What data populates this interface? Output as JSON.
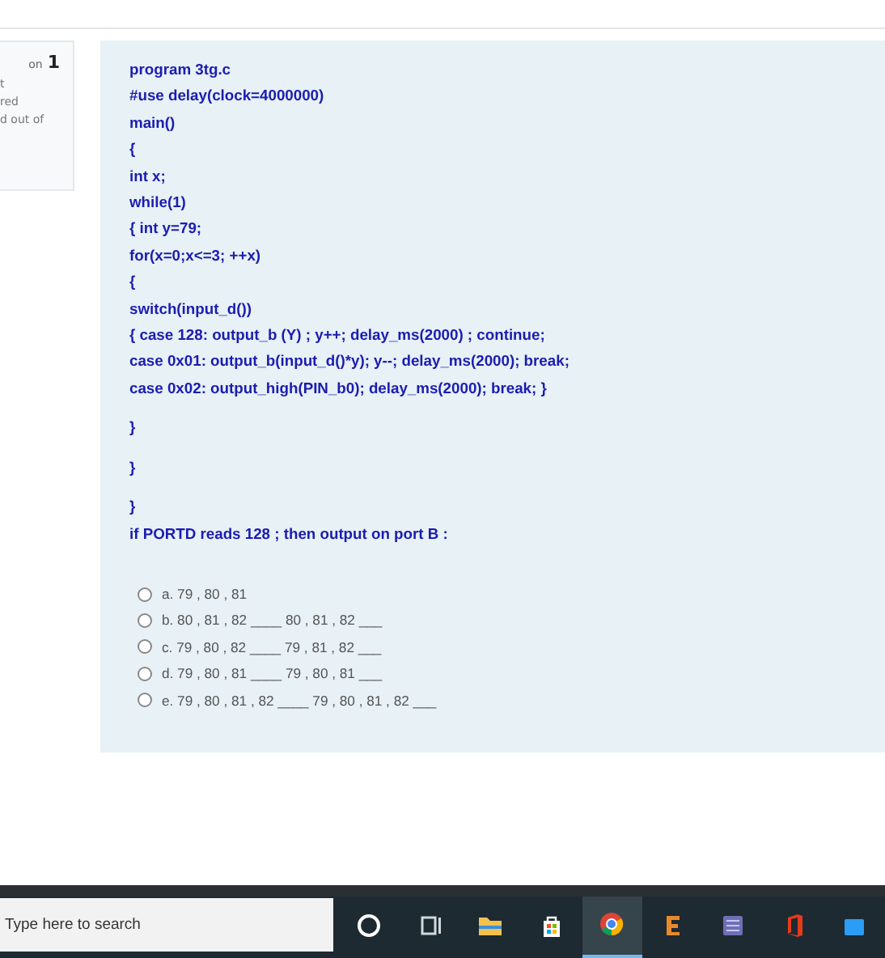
{
  "question_info": {
    "label": "on",
    "number": "1",
    "lines": [
      "t",
      "red",
      "d out of"
    ]
  },
  "code_paragraphs": [
    [
      "program 3tg.c",
      "#use delay(clock=4000000)",
      "main()",
      "{",
      "int x;",
      "while(1)",
      "{ int y=79;",
      "for(x=0;x<=3; ++x)",
      "{",
      "switch(input_d())",
      "{ case 128: output_b (Y) ; y++; delay_ms(2000) ; continue;",
      "case 0x01: output_b(input_d()*y); y--; delay_ms(2000); break;",
      "case 0x02: output_high(PIN_b0); delay_ms(2000); break; }"
    ],
    [
      "}"
    ],
    [
      "}"
    ],
    [
      "}",
      "if PORTD reads 128 ; then output on port B :"
    ]
  ],
  "options": [
    {
      "label": "a. 79 , 80 , 81",
      "selected": false
    },
    {
      "label": "b. 80 , 81 , 82 ____ 80 , 81 , 82 ___",
      "selected": false
    },
    {
      "label": "c. 79 , 80 , 82 ____ 79 , 81 , 82 ___",
      "selected": false
    },
    {
      "label": "d. 79 , 80 , 81 ____ 79 , 80 , 81  ___",
      "selected": false
    },
    {
      "label": "e. 79 , 80 , 81 , 82 ____ 79 , 80 , 81 , 82 ___",
      "selected": false
    }
  ],
  "taskbar": {
    "search": {
      "placeholder": "Type here to search"
    },
    "apps": [
      {
        "kind": "cortana",
        "selected": false
      },
      {
        "kind": "taskview",
        "selected": false
      },
      {
        "kind": "folder",
        "selected": false
      },
      {
        "kind": "store",
        "selected": false
      },
      {
        "kind": "chrome",
        "selected": true
      },
      {
        "kind": "e",
        "selected": false
      },
      {
        "kind": "grid",
        "selected": false
      },
      {
        "kind": "office",
        "selected": false
      },
      {
        "kind": "blue",
        "selected": false
      }
    ]
  }
}
